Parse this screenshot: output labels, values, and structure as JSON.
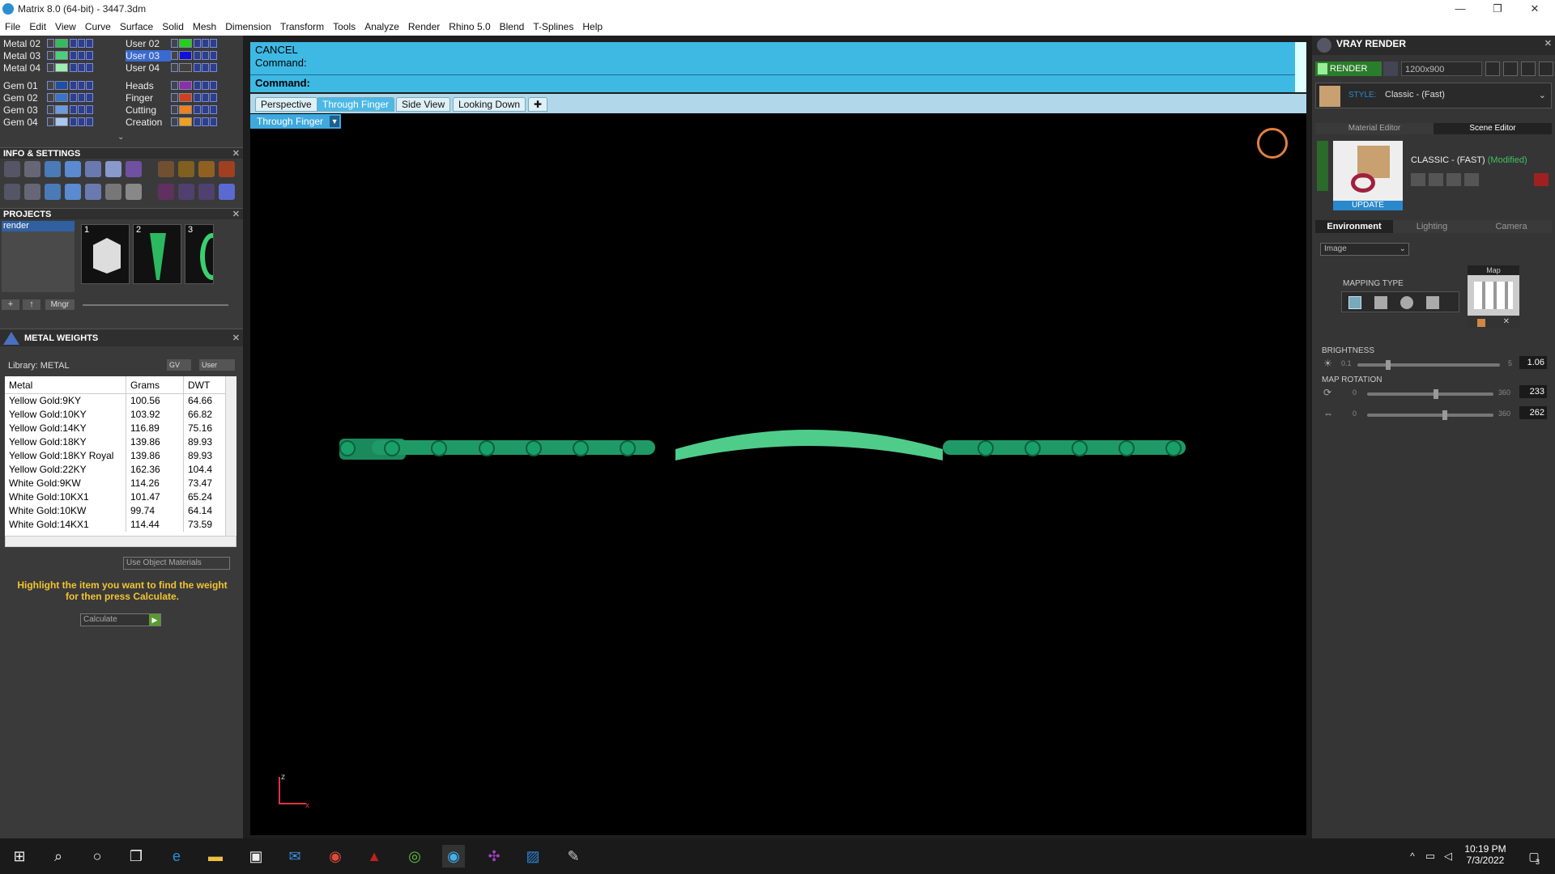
{
  "window": {
    "title": "Matrix 8.0 (64-bit) - 3447.3dm",
    "min": "—",
    "max": "❐",
    "close": "✕"
  },
  "menu": [
    "File",
    "Edit",
    "View",
    "Curve",
    "Surface",
    "Solid",
    "Mesh",
    "Dimension",
    "Transform",
    "Tools",
    "Analyze",
    "Render",
    "Rhino 5.0",
    "Blend",
    "T-Splines",
    "Help"
  ],
  "layers_left": [
    {
      "name": "Metal 02",
      "color": "#2fbf5a"
    },
    {
      "name": "Metal 03",
      "color": "#4ad07a"
    },
    {
      "name": "Metal 04",
      "color": "#9ef0b0"
    },
    {
      "name": "Gem 01",
      "color": "#1d4fa8"
    },
    {
      "name": "Gem 02",
      "color": "#3a74c8"
    },
    {
      "name": "Gem 03",
      "color": "#6a9be0"
    },
    {
      "name": "Gem 04",
      "color": "#a8c8f0"
    }
  ],
  "layers_right": [
    {
      "name": "User 02",
      "color": "#22d022"
    },
    {
      "name": "User 03",
      "color": "#1010d8",
      "selected": true
    },
    {
      "name": "User 04",
      "color": "#404040"
    },
    {
      "name": "Heads",
      "color": "#8a2fb0"
    },
    {
      "name": "Finger",
      "color": "#d04020"
    },
    {
      "name": "Cutting",
      "color": "#f08020"
    },
    {
      "name": "Creation",
      "color": "#f0a020"
    }
  ],
  "info_settings": {
    "title": "INFO & SETTINGS"
  },
  "projects": {
    "title": "PROJECTS",
    "list_item": "render",
    "thumbs": [
      "1",
      "2",
      "3"
    ],
    "mngr": "Mngr"
  },
  "metal_weights": {
    "title": "METAL WEIGHTS",
    "library": "Library: METAL",
    "gv": "GV",
    "user": "User",
    "headers": [
      "Metal",
      "Grams",
      "DWT"
    ],
    "rows": [
      [
        "Yellow Gold:9KY",
        "100.56",
        "64.66"
      ],
      [
        "Yellow Gold:10KY",
        "103.92",
        "66.82"
      ],
      [
        "Yellow Gold:14KY",
        "116.89",
        "75.16"
      ],
      [
        "Yellow Gold:18KY",
        "139.86",
        "89.93"
      ],
      [
        "Yellow Gold:18KY Royal",
        "139.86",
        "89.93"
      ],
      [
        "Yellow Gold:22KY",
        "162.36",
        "104.4"
      ],
      [
        "White Gold:9KW",
        "114.26",
        "73.47"
      ],
      [
        "White Gold:10KX1",
        "101.47",
        "65.24"
      ],
      [
        "White Gold:10KW",
        "99.74",
        "64.14"
      ],
      [
        "White Gold:14KX1",
        "114.44",
        "73.59"
      ]
    ],
    "use_object_materials": "Use Object Materials",
    "hint": "Highlight the item you want to find the weight for then press Calculate.",
    "calculate": "Calculate"
  },
  "command": {
    "line1": "CANCEL",
    "line2": "Command:",
    "prompt": "Command:"
  },
  "view_tabs": [
    "Perspective",
    "Through Finger",
    "Side View",
    "Looking Down"
  ],
  "active_view": "Through Finger",
  "axis": {
    "z": "z",
    "x": "x"
  },
  "vray": {
    "title": "VRAY RENDER",
    "render": "RENDER",
    "resolution": "1200x900",
    "style_label": "STYLE:",
    "style_value": "Classic - (Fast)",
    "tab_material": "Material Editor",
    "tab_scene": "Scene Editor",
    "preset": "CLASSIC - (FAST)",
    "modified": "(Modified)",
    "update": "UPDATE",
    "env_tabs": [
      "Environment",
      "Lighting",
      "Camera"
    ],
    "env_type": "Image",
    "map_label": "Map",
    "mapping_type": "MAPPING TYPE",
    "brightness": {
      "label": "BRIGHTNESS",
      "min": "0.1",
      "max": "5",
      "value": "1.06",
      "level": 0.2
    },
    "map_rotation": {
      "label": "MAP ROTATION",
      "min": "0",
      "max": "360",
      "value1": "233",
      "value2": "262"
    }
  },
  "taskbar": {
    "time": "10:19 PM",
    "date": "7/3/2022",
    "notif": "3"
  }
}
